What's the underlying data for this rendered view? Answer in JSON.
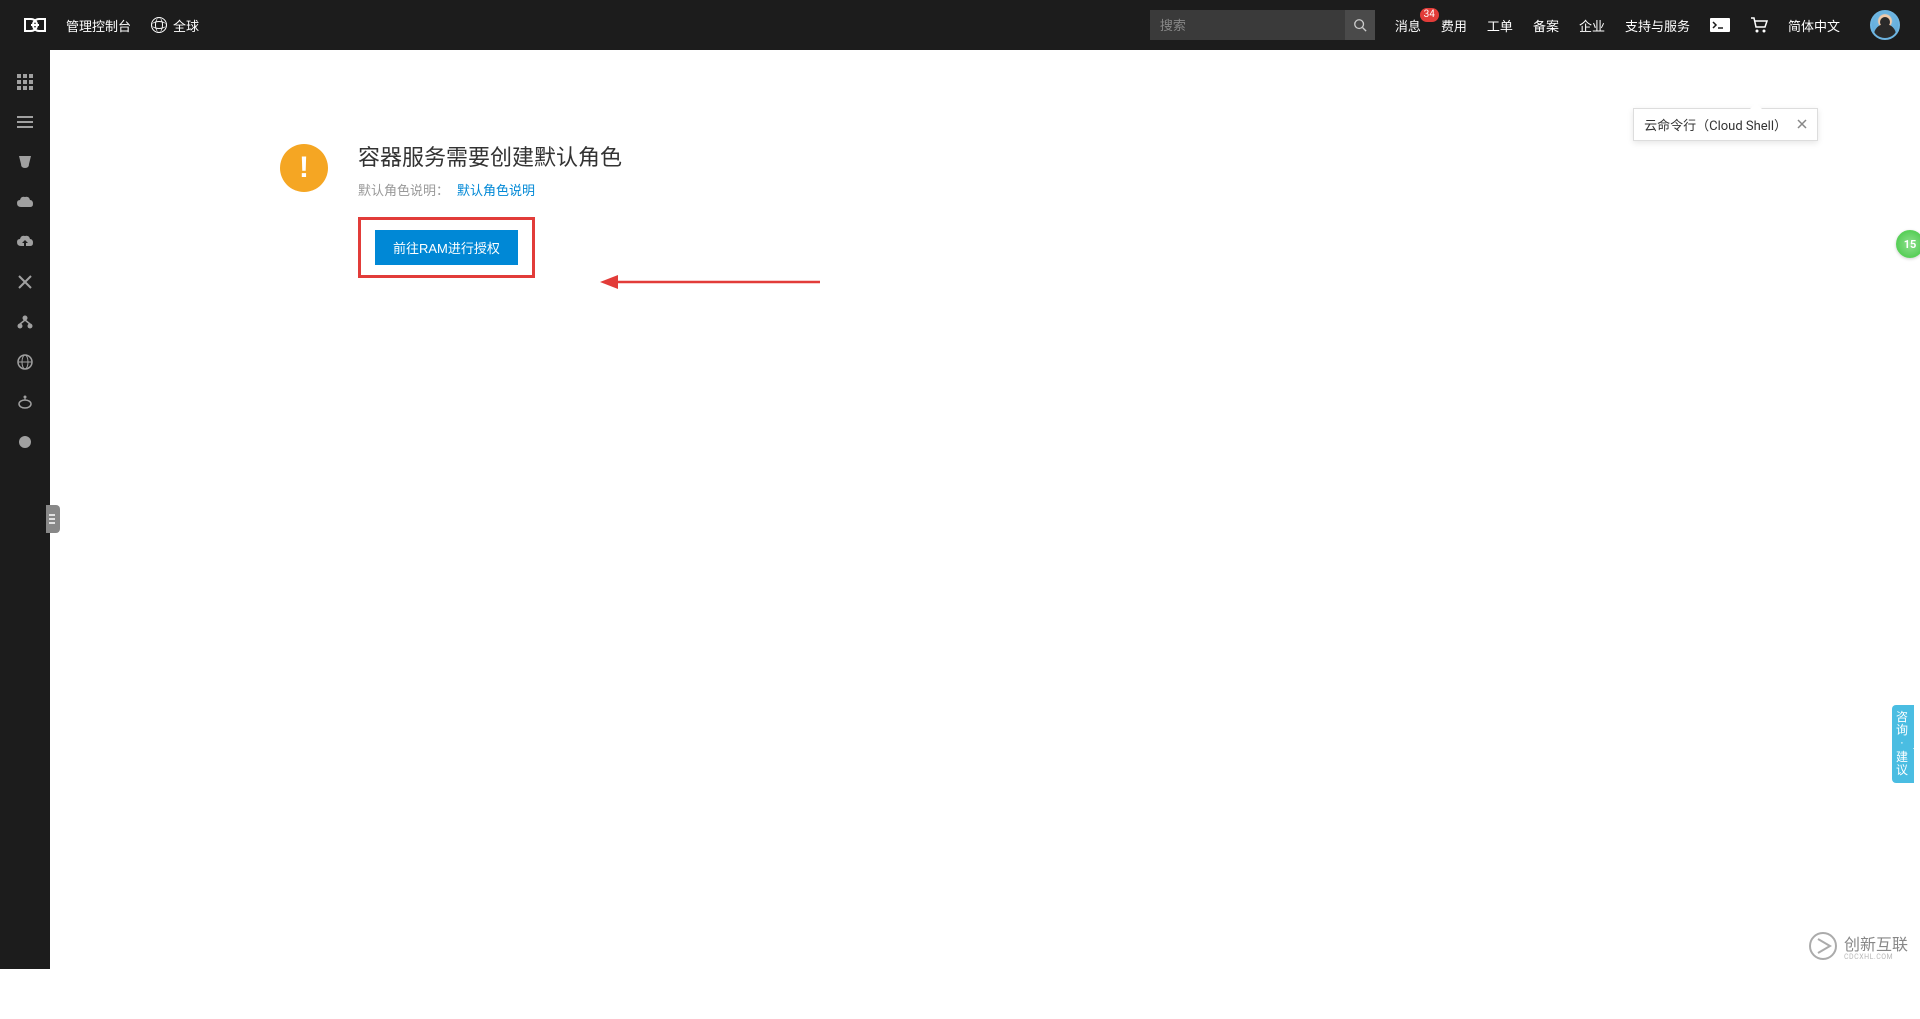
{
  "header": {
    "console_title": "管理控制台",
    "region": "全球",
    "search_placeholder": "搜索",
    "nav": {
      "messages": "消息",
      "messages_badge": "34",
      "billing": "费用",
      "tickets": "工单",
      "icp": "备案",
      "enterprise": "企业",
      "support": "支持与服务",
      "language": "简体中文"
    }
  },
  "tooltip": {
    "text": "云命令行（Cloud Shell）"
  },
  "sidebar": {
    "items": [
      {
        "name": "apps-icon"
      },
      {
        "name": "list-icon"
      },
      {
        "name": "cup-icon"
      },
      {
        "name": "cloud-icon"
      },
      {
        "name": "cloud-up-icon"
      },
      {
        "name": "cross-icon"
      },
      {
        "name": "tree-icon"
      },
      {
        "name": "globe-icon"
      },
      {
        "name": "bot-icon"
      },
      {
        "name": "circle-icon"
      }
    ]
  },
  "main": {
    "alert_title": "容器服务需要创建默认角色",
    "alert_subtitle_prefix": "默认角色说明：",
    "alert_link": "默认角色说明",
    "ram_button": "前往RAM进行授权"
  },
  "float_badge": "15",
  "feedback": "咨询·建议",
  "watermark": {
    "brand": "创新互联",
    "sub": "CDCXHL.COM"
  }
}
